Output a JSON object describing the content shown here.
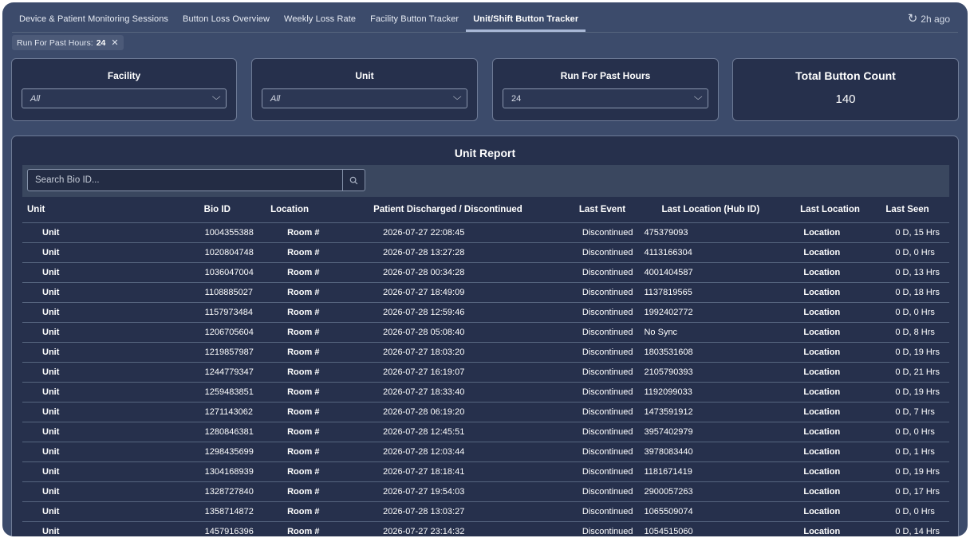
{
  "tabs": [
    {
      "label": "Device & Patient Monitoring Sessions",
      "active": false
    },
    {
      "label": "Button Loss Overview",
      "active": false
    },
    {
      "label": "Weekly Loss Rate",
      "active": false
    },
    {
      "label": "Facility Button Tracker",
      "active": false
    },
    {
      "label": "Unit/Shift Button Tracker",
      "active": true
    }
  ],
  "refresh": {
    "icon": "refresh-icon",
    "label": "2h ago"
  },
  "filter_chip": {
    "label": "Run For Past Hours:",
    "value": "24",
    "close_icon": "close-icon"
  },
  "filters": {
    "facility": {
      "title": "Facility",
      "value": "All"
    },
    "unit": {
      "title": "Unit",
      "value": "All"
    },
    "hours": {
      "title": "Run For Past Hours",
      "value": "24"
    }
  },
  "total": {
    "title": "Total Button Count",
    "value": "140"
  },
  "report": {
    "title": "Unit Report",
    "search_placeholder": "Search Bio ID...",
    "columns": [
      "Unit",
      "Bio ID",
      "Location",
      "Patient Discharged / Discontinued",
      "Last Event",
      "Last Location (Hub ID)",
      "Last Location",
      "Last Seen"
    ],
    "rows": [
      [
        "Unit",
        "1004355388",
        "Room #",
        "2026-07-27 22:08:45",
        "Discontinued",
        "475379093",
        "Location",
        "0 D, 15 Hrs"
      ],
      [
        "Unit",
        "1020804748",
        "Room #",
        "2026-07-28 13:27:28",
        "Discontinued",
        "4113166304",
        "Location",
        "0 D, 0 Hrs"
      ],
      [
        "Unit",
        "1036047004",
        "Room #",
        "2026-07-28 00:34:28",
        "Discontinued",
        "4001404587",
        "Location",
        "0 D, 13 Hrs"
      ],
      [
        "Unit",
        "1108885027",
        "Room #",
        "2026-07-27 18:49:09",
        "Discontinued",
        "1137819565",
        "Location",
        "0 D, 18 Hrs"
      ],
      [
        "Unit",
        "1157973484",
        "Room #",
        "2026-07-28 12:59:46",
        "Discontinued",
        "1992402772",
        "Location",
        "0 D, 0 Hrs"
      ],
      [
        "Unit",
        "1206705604",
        "Room #",
        "2026-07-28 05:08:40",
        "Discontinued",
        "No Sync",
        "Location",
        "0 D, 8 Hrs"
      ],
      [
        "Unit",
        "1219857987",
        "Room #",
        "2026-07-27 18:03:20",
        "Discontinued",
        "1803531608",
        "Location",
        "0 D, 19 Hrs"
      ],
      [
        "Unit",
        "1244779347",
        "Room #",
        "2026-07-27 16:19:07",
        "Discontinued",
        "2105790393",
        "Location",
        "0 D, 21 Hrs"
      ],
      [
        "Unit",
        "1259483851",
        "Room #",
        "2026-07-27 18:33:40",
        "Discontinued",
        "1192099033",
        "Location",
        "0 D, 19 Hrs"
      ],
      [
        "Unit",
        "1271143062",
        "Room #",
        "2026-07-28 06:19:20",
        "Discontinued",
        "1473591912",
        "Location",
        "0 D, 7 Hrs"
      ],
      [
        "Unit",
        "1280846381",
        "Room #",
        "2026-07-28 12:45:51",
        "Discontinued",
        "3957402979",
        "Location",
        "0 D, 0 Hrs"
      ],
      [
        "Unit",
        "1298435699",
        "Room #",
        "2026-07-28 12:03:44",
        "Discontinued",
        "3978083440",
        "Location",
        "0 D, 1 Hrs"
      ],
      [
        "Unit",
        "1304168939",
        "Room #",
        "2026-07-27 18:18:41",
        "Discontinued",
        "1181671419",
        "Location",
        "0 D, 19 Hrs"
      ],
      [
        "Unit",
        "1328727840",
        "Room #",
        "2026-07-27 19:54:03",
        "Discontinued",
        "2900057263",
        "Location",
        "0 D, 17 Hrs"
      ],
      [
        "Unit",
        "1358714872",
        "Room #",
        "2026-07-28 13:03:27",
        "Discontinued",
        "1065509074",
        "Location",
        "0 D, 0 Hrs"
      ],
      [
        "Unit",
        "1457916396",
        "Room #",
        "2026-07-27 23:14:32",
        "Discontinued",
        "1054515060",
        "Location",
        "0 D, 14 Hrs"
      ]
    ]
  }
}
